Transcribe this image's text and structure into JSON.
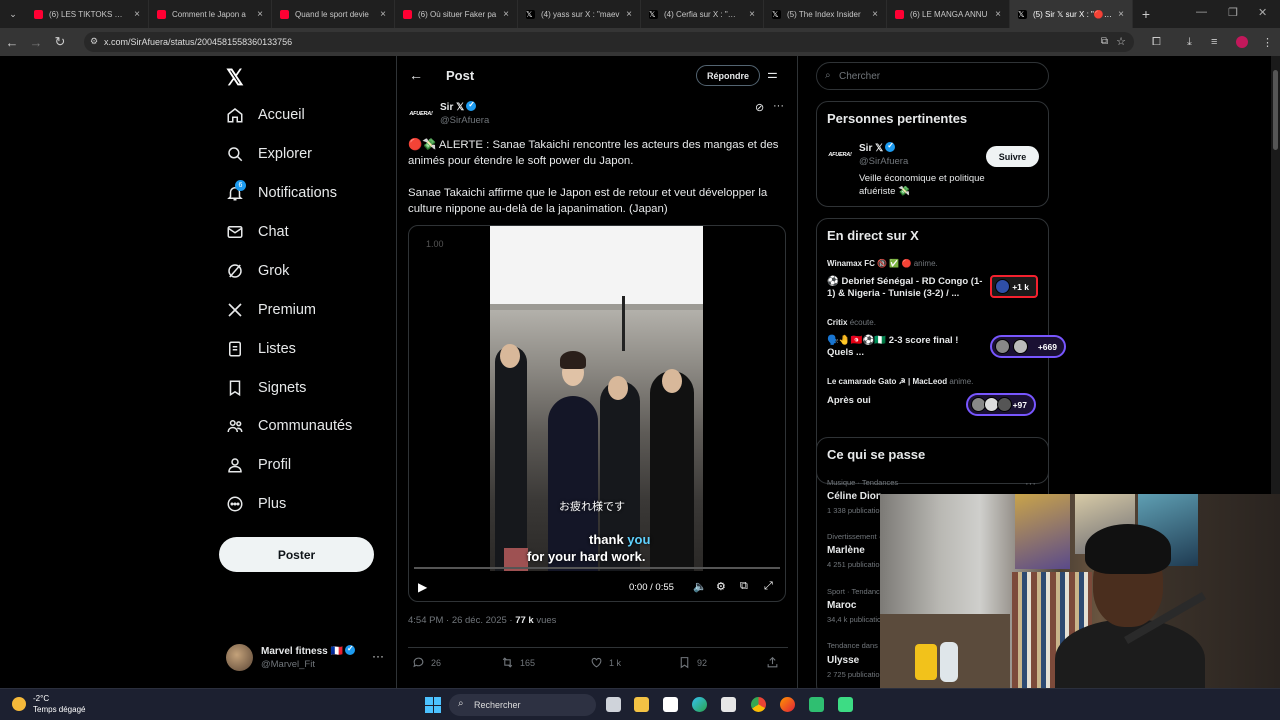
{
  "browser": {
    "tabs": [
      {
        "title": "(6) LES TIKTOKS DES",
        "icon": "youtube-icon",
        "color": "#ff0033"
      },
      {
        "title": "Comment le Japon a",
        "icon": "youtube-icon",
        "color": "#ff0033"
      },
      {
        "title": "Quand le sport devie",
        "icon": "youtube-icon",
        "color": "#ff0033"
      },
      {
        "title": "(6) Où situer Faker pa",
        "icon": "youtube-icon",
        "color": "#ff0033"
      },
      {
        "title": "(4) yass sur X : \"maev",
        "icon": "x-icon",
        "color": "#ffffff"
      },
      {
        "title": "(4) Cerfia sur X : \"🇫🇷 F",
        "icon": "x-icon",
        "color": "#ffffff"
      },
      {
        "title": "(5) The Index Insider",
        "icon": "x-icon",
        "color": "#ffffff"
      },
      {
        "title": "(6) LE MANGA ANNU",
        "icon": "youtube-icon",
        "color": "#ff0033"
      },
      {
        "title": "(5) Sir 𝕏 sur X : \"🔴💸",
        "icon": "x-icon",
        "color": "#ffffff"
      }
    ],
    "new_tab": "+",
    "url": "x.com/SirAfuera/status/2004581558360133756"
  },
  "nav": {
    "items": [
      {
        "label": "Accueil",
        "icon": "home-icon"
      },
      {
        "label": "Explorer",
        "icon": "search-icon"
      },
      {
        "label": "Notifications",
        "icon": "bell-icon",
        "badge": "6"
      },
      {
        "label": "Chat",
        "icon": "mail-icon"
      },
      {
        "label": "Grok",
        "icon": "grok-icon"
      },
      {
        "label": "Premium",
        "icon": "x-premium-icon"
      },
      {
        "label": "Listes",
        "icon": "list-icon"
      },
      {
        "label": "Signets",
        "icon": "bookmark-icon"
      },
      {
        "label": "Communautés",
        "icon": "communities-icon"
      },
      {
        "label": "Profil",
        "icon": "person-icon"
      },
      {
        "label": "Plus",
        "icon": "more-circle-icon"
      }
    ],
    "post_button": "Poster",
    "account": {
      "name": "Marvel fitness 🇫🇷",
      "handle": "@Marvel_Fit"
    }
  },
  "post": {
    "header_title": "Post",
    "reply_button": "Répondre",
    "author": {
      "name": "Sir 𝕏",
      "handle": "@SirAfuera",
      "logo": "AFUERA!"
    },
    "text1": "🔴💸 ALERTE : Sanae Takaichi rencontre les acteurs des mangas et des animés pour étendre le soft power du Japon.",
    "text2": "Sanae Takaichi affirme que le Japon est de retour et veut développer la culture nippone au-delà de la japanimation. (Japan)",
    "video": {
      "speed": "1.00",
      "sub_jp": "お疲れ様です",
      "sub_en_1a": "thank ",
      "sub_en_1b": "you",
      "sub_en_2": "for your hard work.",
      "time": "0:00 / 0:55"
    },
    "meta": {
      "time": "4:54 PM · 26 déc. 2025 · ",
      "views": "77 k",
      "views_label": " vues"
    },
    "actions": {
      "replies": "26",
      "reposts": "165",
      "likes": "1 k",
      "bookmarks": "92"
    }
  },
  "sidebar": {
    "search_placeholder": "Chercher",
    "relevant": {
      "title": "Personnes pertinentes",
      "name": "Sir 𝕏",
      "handle": "@SirAfuera",
      "follow": "Suivre",
      "bio": "Veille économique et politique afuériste 💸"
    },
    "live": {
      "title": "En direct sur X",
      "items": [
        {
          "host": "Winamax FC 🔞 ✅ 🔴",
          "status": "anime.",
          "title": "⚽ Debrief Sénégal - RD Congo (1-1) & Nigeria - Tunisie (3-2) / ...",
          "count": "+1 k"
        },
        {
          "host": "Critix",
          "status": "écoute.",
          "title": "🗣️🤚🇹🇳⚽🇳🇬 2-3 score final ! Quels ...",
          "count": "+669"
        },
        {
          "host": "Le camarade Gato ☭ | MacLeod",
          "status": "anime.",
          "title": "Après oui",
          "count": "+97"
        }
      ]
    },
    "trends": {
      "title": "Ce qui se passe",
      "items": [
        {
          "category": "Musique · Tendances",
          "name": "Céline Dion",
          "count": "1 338 publications"
        },
        {
          "category": "Divertissement · Tendances",
          "name": "Marlène",
          "count": "4 251 publications"
        },
        {
          "category": "Sport · Tendances",
          "name": "Maroc",
          "count": "34,4 k publications"
        },
        {
          "category": "Tendance dans France",
          "name": "Ulysse",
          "count": "2 725 publications"
        }
      ]
    }
  },
  "taskbar": {
    "temp": "-2°C",
    "condition": "Temps dégagé",
    "search": "Rechercher"
  }
}
